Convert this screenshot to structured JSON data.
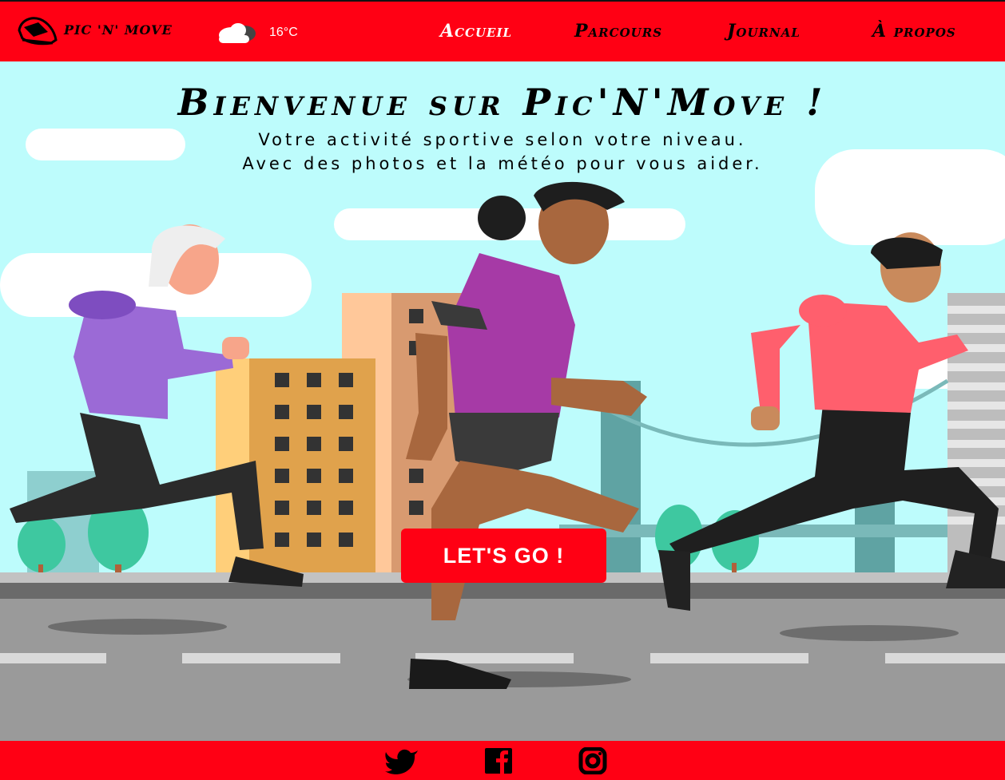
{
  "header": {
    "brand": "PIC 'N' MOVE",
    "temperature": "16°C",
    "nav": [
      {
        "label": "Accueil",
        "active": true
      },
      {
        "label": "Parcours",
        "active": false
      },
      {
        "label": "Journal",
        "active": false
      },
      {
        "label": "À propos",
        "active": false
      }
    ]
  },
  "hero": {
    "title": "Bienvenue sur Pic'N'Move !",
    "subtitle_line1": "Votre activité sportive selon votre niveau.",
    "subtitle_line2": "Avec des photos et la météo pour vous aider.",
    "cta_label": "LET'S GO !"
  },
  "footer": {
    "social": [
      "twitter-icon",
      "facebook-icon",
      "instagram-icon"
    ]
  },
  "colors": {
    "brand_red": "#ff0014",
    "sky": "#bdfcfc",
    "road": "#9a9a9a"
  }
}
